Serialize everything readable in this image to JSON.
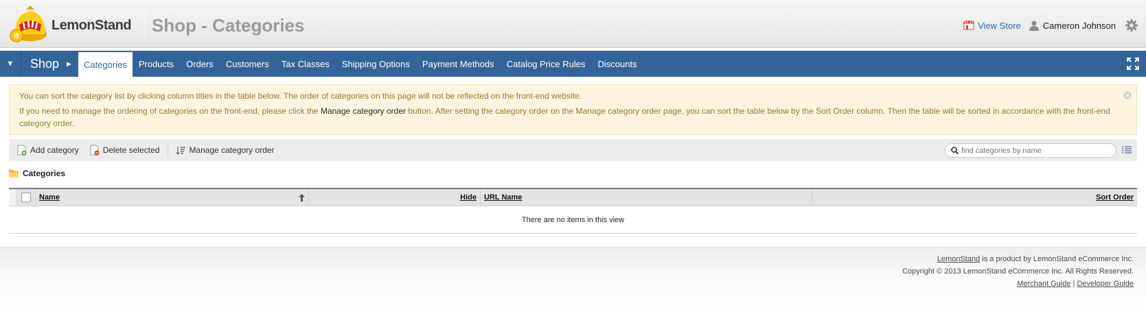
{
  "header": {
    "brand": "LemonStand",
    "page_title": "Shop - Categories",
    "view_store": "View Store",
    "user_name": "Cameron Johnson"
  },
  "nav": {
    "section": "Shop",
    "items": [
      {
        "label": "Categories",
        "active": true
      },
      {
        "label": "Products"
      },
      {
        "label": "Orders"
      },
      {
        "label": "Customers"
      },
      {
        "label": "Tax Classes"
      },
      {
        "label": "Shipping Options"
      },
      {
        "label": "Payment Methods"
      },
      {
        "label": "Catalog Price Rules"
      },
      {
        "label": "Discounts"
      }
    ]
  },
  "notice": {
    "line1": "You can sort the category list by clicking column titles in the table below. The order of categories on this page will not be reflected on the front-end website.",
    "line2_a": "If you need to manage the ordering of categories on the front-end, please click the ",
    "line2_b": "Manage category order",
    "line2_c": " button. After setting the category order on the Manage category order page, you can sort the table below by the Sort Order column. Then the table will be sorted in accordance with the front-end category order."
  },
  "toolbar": {
    "add": "Add category",
    "delete": "Delete selected",
    "manage": "Manage category order",
    "search_placeholder": "find categories by name"
  },
  "section_title": "Categories",
  "table": {
    "columns": [
      "Name",
      "Hide",
      "URL Name",
      "Sort Order"
    ],
    "empty": "There are no items in this view"
  },
  "footer": {
    "link_brand": "LemonStand",
    "line1_rest": " is a product by LemonStand eCommerce Inc.",
    "line2": "Copyright © 2013 LemonStand eCommerce Inc. All Rights Reserved.",
    "merchant": "Merchant Guide",
    "divider": "|",
    "developer": "Developer Guide"
  },
  "colors": {
    "nav_bg": "#326499",
    "link": "#2c6aa3",
    "notice_bg": "#fdf5e0",
    "notice_text": "#9a7a2e"
  }
}
